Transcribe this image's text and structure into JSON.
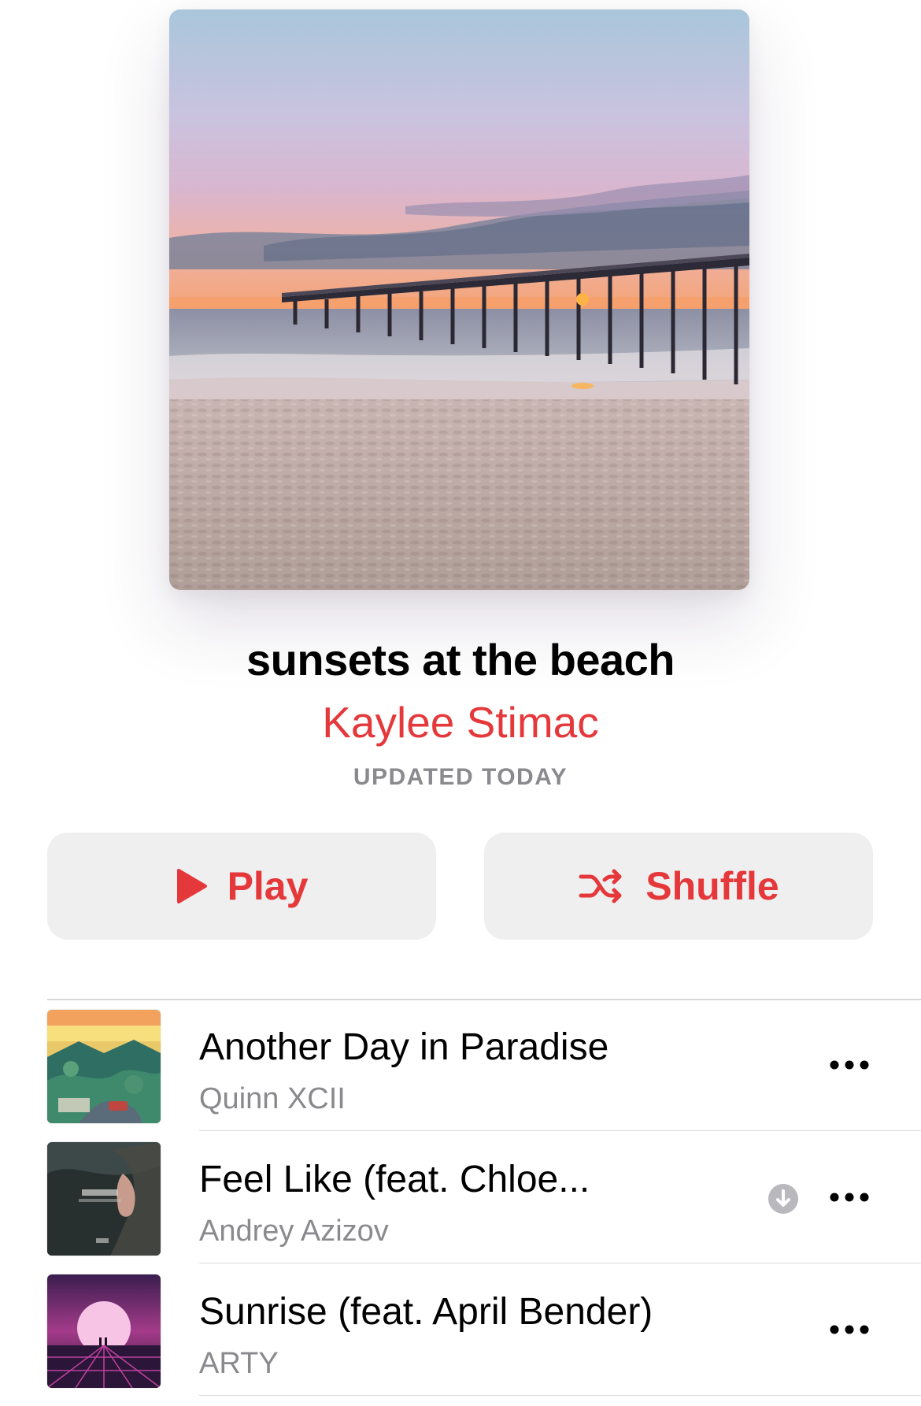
{
  "playlist": {
    "title": "sunsets at the beach",
    "curator": "Kaylee Stimac",
    "updated": "UPDATED TODAY",
    "artwork_icon": "beach-pier-sunset-photo"
  },
  "actions": {
    "play_label": "Play",
    "shuffle_label": "Shuffle",
    "play_icon": "play-icon",
    "shuffle_icon": "shuffle-icon"
  },
  "colors": {
    "accent": "#e5383b",
    "secondary_text": "#8a8a8e",
    "button_bg": "#efeff0"
  },
  "tracks": [
    {
      "title": "Another Day in Paradise",
      "artist": "Quinn XCII",
      "downloaded": false
    },
    {
      "title": "Feel Like (feat. Chloe...",
      "artist": "Andrey Azizov",
      "downloaded": true
    },
    {
      "title": "Sunrise (feat. April Bender)",
      "artist": "ARTY",
      "downloaded": false
    }
  ]
}
